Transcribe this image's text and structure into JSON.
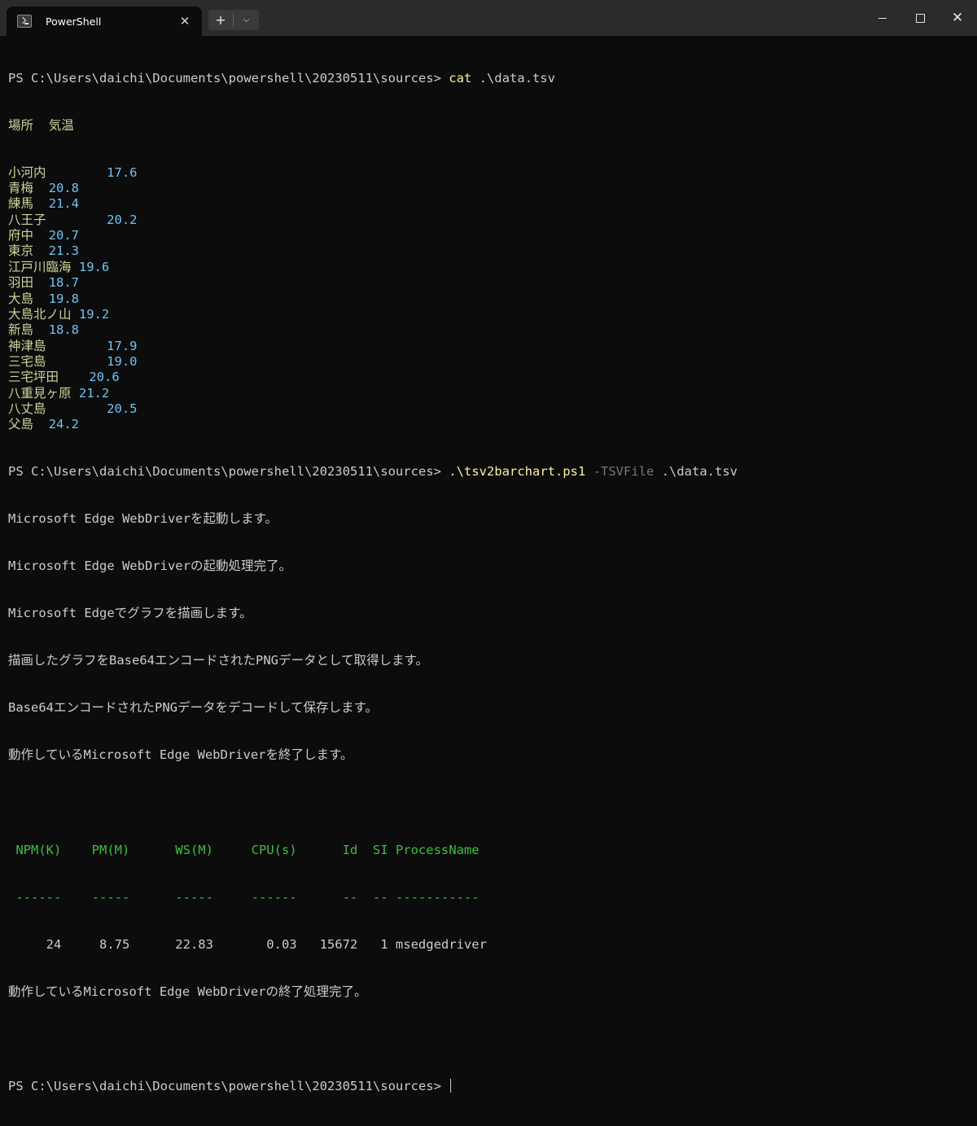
{
  "window": {
    "tab_title": "PowerShell",
    "tab_close": "✕",
    "new_tab": "+",
    "dropdown": "⌵",
    "close": "✕"
  },
  "terminal": {
    "prompt1": "PS C:\\Users\\daichi\\Documents\\powershell\\20230511\\sources> ",
    "cmd1": "cat",
    "cmd1_args": " .\\data.tsv",
    "tsv_header": {
      "loc": "場所",
      "sep": "  ",
      "val": "気温"
    },
    "tsv_rows": [
      {
        "loc": "小河内",
        "sep": "        ",
        "val": "17.6"
      },
      {
        "loc": "青梅",
        "sep": "  ",
        "val": "20.8"
      },
      {
        "loc": "練馬",
        "sep": "  ",
        "val": "21.4"
      },
      {
        "loc": "八王子",
        "sep": "        ",
        "val": "20.2"
      },
      {
        "loc": "府中",
        "sep": "  ",
        "val": "20.7"
      },
      {
        "loc": "東京",
        "sep": "  ",
        "val": "21.3"
      },
      {
        "loc": "江戸川臨海",
        "sep": " ",
        "val": "19.6"
      },
      {
        "loc": "羽田",
        "sep": "  ",
        "val": "18.7"
      },
      {
        "loc": "大島",
        "sep": "  ",
        "val": "19.8"
      },
      {
        "loc": "大島北ノ山",
        "sep": " ",
        "val": "19.2"
      },
      {
        "loc": "新島",
        "sep": "  ",
        "val": "18.8"
      },
      {
        "loc": "神津島",
        "sep": "        ",
        "val": "17.9"
      },
      {
        "loc": "三宅島",
        "sep": "        ",
        "val": "19.0"
      },
      {
        "loc": "三宅坪田",
        "sep": "    ",
        "val": "20.6"
      },
      {
        "loc": "八重見ヶ原",
        "sep": " ",
        "val": "21.2"
      },
      {
        "loc": "八丈島",
        "sep": "        ",
        "val": "20.5"
      },
      {
        "loc": "父島",
        "sep": "  ",
        "val": "24.2"
      }
    ],
    "prompt2": "PS C:\\Users\\daichi\\Documents\\powershell\\20230511\\sources> ",
    "cmd2": ".\\tsv2barchart.ps1",
    "cmd2_param": " -TSVFile",
    "cmd2_args": " .\\data.tsv",
    "messages": [
      "Microsoft Edge WebDriverを起動します。",
      "Microsoft Edge WebDriverの起動処理完了。",
      "Microsoft Edgeでグラフを描画します。",
      "描画したグラフをBase64エンコードされたPNGデータとして取得します。",
      "Base64エンコードされたPNGデータをデコードして保存します。",
      "動作しているMicrosoft Edge WebDriverを終了します。"
    ],
    "table_header": " NPM(K)    PM(M)      WS(M)     CPU(s)      Id  SI ProcessName",
    "table_dashes": " ------    -----      -----     ------      --  -- -----------",
    "table_row": "     24     8.75      22.83       0.03   15672   1 msedgedriver",
    "final_message": "動作しているMicrosoft Edge WebDriverの終了処理完了。",
    "prompt3": "PS C:\\Users\\daichi\\Documents\\powershell\\20230511\\sources> "
  }
}
